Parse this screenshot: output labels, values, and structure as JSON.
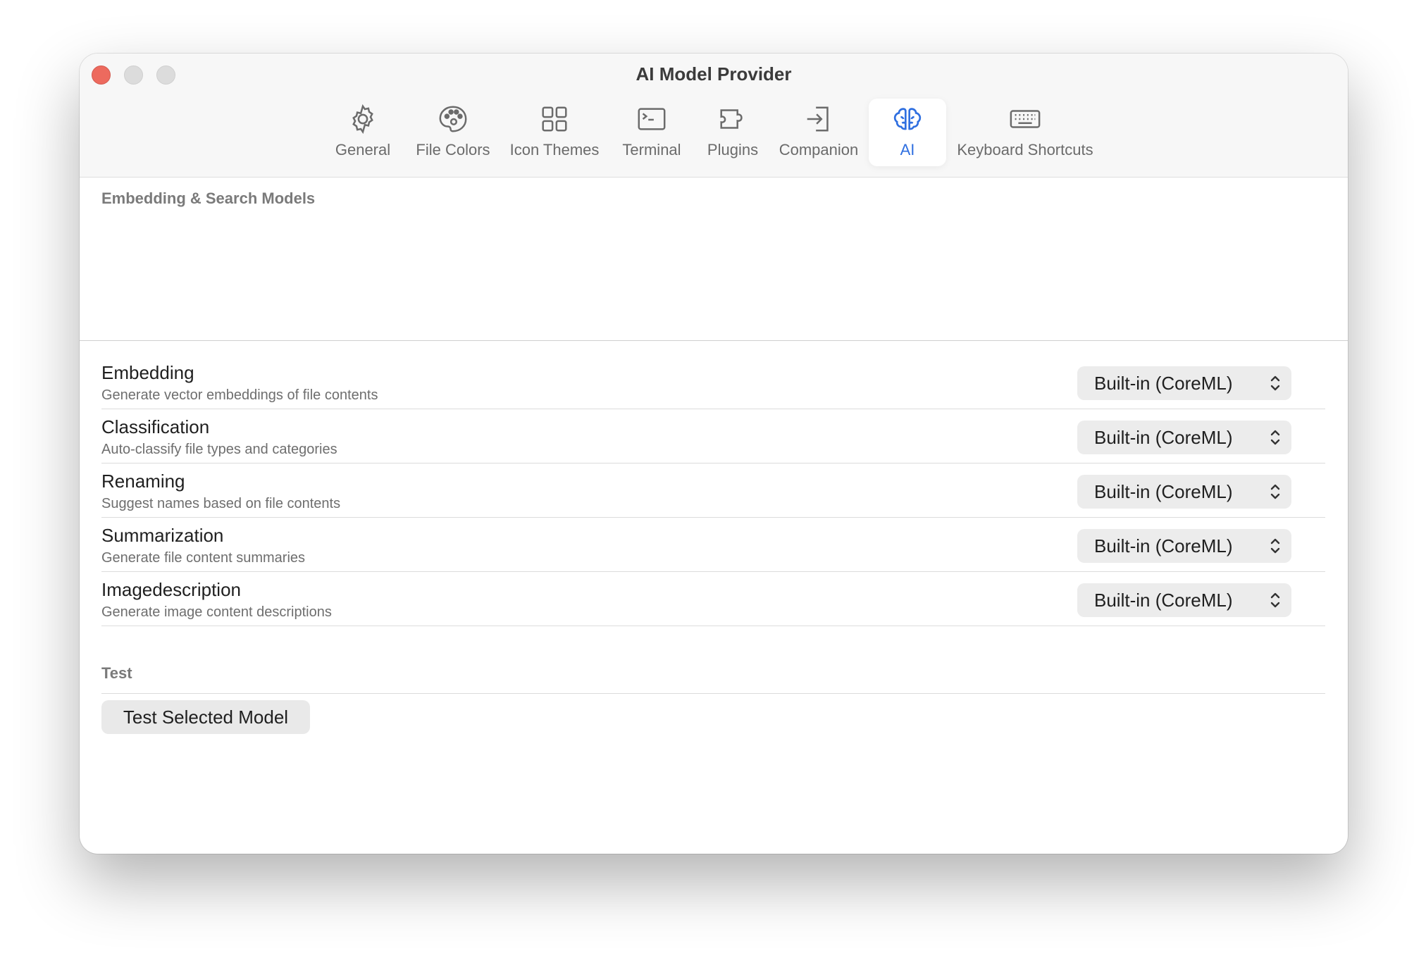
{
  "window": {
    "title": "AI Model Provider"
  },
  "tabs": [
    {
      "label": "General",
      "icon": "gear-icon"
    },
    {
      "label": "File Colors",
      "icon": "palette-icon"
    },
    {
      "label": "Icon Themes",
      "icon": "grid-icon"
    },
    {
      "label": "Terminal",
      "icon": "terminal-icon"
    },
    {
      "label": "Plugins",
      "icon": "puzzle-icon"
    },
    {
      "label": "Companion",
      "icon": "sign-in-icon"
    },
    {
      "label": "AI",
      "icon": "brain-icon",
      "active": true
    },
    {
      "label": "Keyboard Shortcuts",
      "icon": "keyboard-icon"
    }
  ],
  "colors": {
    "accent": "#2f6fe0",
    "close": "#ed6a5e"
  },
  "embedding_section": {
    "label": "Embedding & Search Models"
  },
  "models": [
    {
      "title": "Embedding",
      "subtitle": "Generate vector embeddings of file contents",
      "value": "Built-in (CoreML)"
    },
    {
      "title": "Classification",
      "subtitle": "Auto-classify file types and categories",
      "value": "Built-in (CoreML)"
    },
    {
      "title": "Renaming",
      "subtitle": "Suggest names based on file contents",
      "value": "Built-in (CoreML)"
    },
    {
      "title": "Summarization",
      "subtitle": "Generate file content summaries",
      "value": "Built-in (CoreML)"
    },
    {
      "title": "Imagedescription",
      "subtitle": "Generate image content descriptions",
      "value": "Built-in (CoreML)"
    }
  ],
  "test_section": {
    "label": "Test",
    "button_label": "Test Selected Model"
  }
}
